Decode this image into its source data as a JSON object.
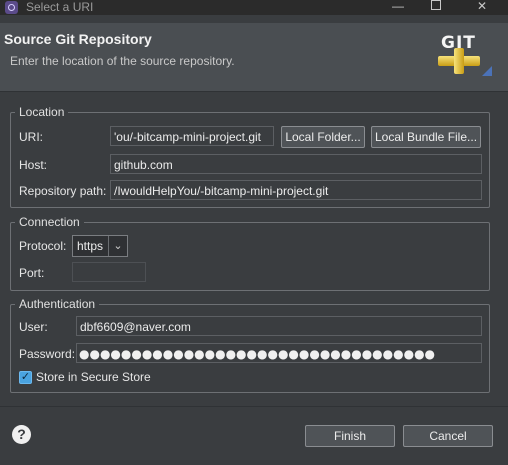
{
  "window": {
    "title": "Select a URI",
    "minimize_glyph": "—",
    "close_glyph": "✕"
  },
  "header": {
    "title": "Source Git Repository",
    "subtitle": "Enter the location of the source repository.",
    "logo_text": "GIT"
  },
  "location": {
    "legend": "Location",
    "uri_label": "URI:",
    "uri_value": "'ou/-bitcamp-mini-project.git",
    "local_folder_button": "Local Folder...",
    "local_bundle_button": "Local Bundle File...",
    "host_label": "Host:",
    "host_value": "github.com",
    "repo_path_label": "Repository path:",
    "repo_path_value": "/IwouldHelpYou/-bitcamp-mini-project.git"
  },
  "connection": {
    "legend": "Connection",
    "protocol_label": "Protocol:",
    "protocol_value": "https",
    "port_label": "Port:",
    "port_value": ""
  },
  "authentication": {
    "legend": "Authentication",
    "user_label": "User:",
    "user_value": "dbf6609@naver.com",
    "password_label": "Password:",
    "password_mask": "●●●●●●●●●●●●●●●●●●●●●●●●●●●●●●●●●●",
    "store_label": "Store in Secure Store",
    "store_checked": true
  },
  "footer": {
    "help_glyph": "?",
    "finish_button": "Finish",
    "cancel_button": "Cancel"
  },
  "colors": {
    "background": "#3a3d40",
    "header_background": "#4a4e52",
    "checkbox_accent": "#4aa3e0"
  },
  "icons": [
    "app-icon",
    "git-logo-icon",
    "chevron-down-icon",
    "help-icon",
    "checkmark-icon"
  ]
}
